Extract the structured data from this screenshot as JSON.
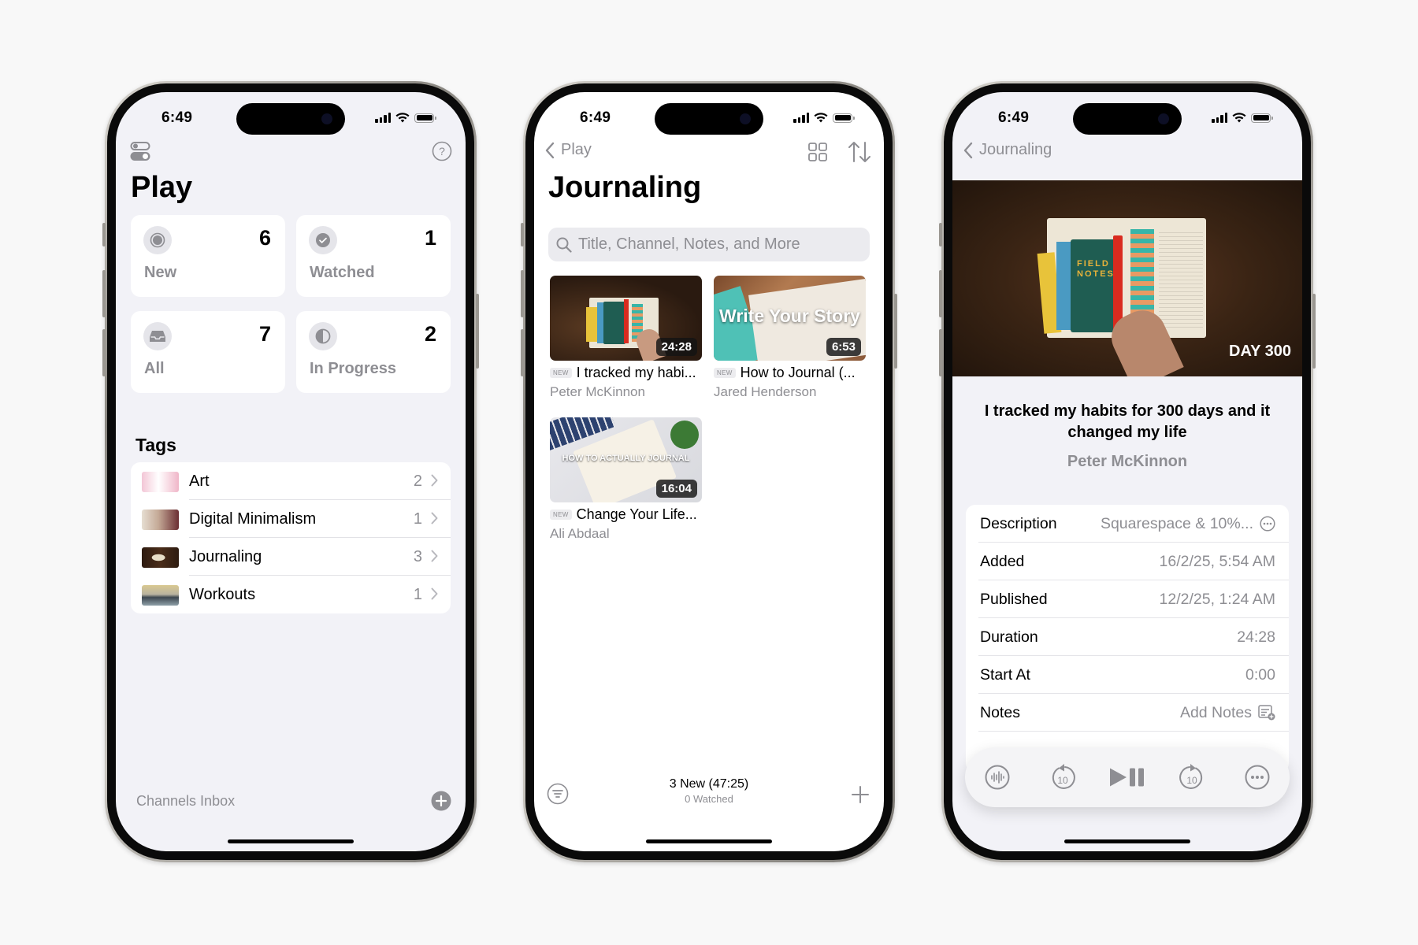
{
  "status_bar": {
    "time": "6:49"
  },
  "phone1": {
    "title": "Play",
    "cards": [
      {
        "label": "New",
        "count": "6",
        "icon": "record-circle-icon"
      },
      {
        "label": "Watched",
        "count": "1",
        "icon": "checkmark-circle-icon"
      },
      {
        "label": "All",
        "count": "7",
        "icon": "tray-icon"
      },
      {
        "label": "In Progress",
        "count": "2",
        "icon": "half-circle-icon"
      }
    ],
    "tags_header": "Tags",
    "tags": [
      {
        "name": "Art",
        "count": "2",
        "thumb_colors": [
          "#f3c6d6",
          "#ffffff"
        ]
      },
      {
        "name": "Digital Minimalism",
        "count": "1",
        "thumb_colors": [
          "#d9cbb8",
          "#6b2e33"
        ]
      },
      {
        "name": "Journaling",
        "count": "3",
        "thumb_colors": [
          "#3b2416",
          "#2f6f66"
        ]
      },
      {
        "name": "Workouts",
        "count": "1",
        "thumb_colors": [
          "#c9b98a",
          "#3d4750"
        ]
      }
    ],
    "footer_label": "Channels Inbox"
  },
  "phone2": {
    "back_label": "Play",
    "title": "Journaling",
    "search_placeholder": "Title, Channel, Notes, and More",
    "videos": [
      {
        "badge": "NEW",
        "title": "I tracked my habi...",
        "channel": "Peter McKinnon",
        "duration": "24:28",
        "overlay": ""
      },
      {
        "badge": "NEW",
        "title": "How to Journal (...",
        "channel": "Jared Henderson",
        "duration": "6:53",
        "overlay": "Write Your Story"
      },
      {
        "badge": "NEW",
        "title": "Change Your Life...",
        "channel": "Ali Abdaal",
        "duration": "16:04",
        "overlay": "HOW TO ACTUALLY JOURNAL"
      }
    ],
    "summary_primary": "3 New (47:25)",
    "summary_secondary": "0 Watched"
  },
  "phone3": {
    "back_label": "Journaling",
    "hero_overlay": "DAY 300",
    "video_title": "I tracked my habits for 300 days and it changed my life",
    "channel": "Peter McKinnon",
    "details": [
      {
        "key": "Description",
        "value": "Squarespace & 10%...",
        "icon": "ellipsis-circle-icon"
      },
      {
        "key": "Added",
        "value": "16/2/25, 5:54 AM"
      },
      {
        "key": "Published",
        "value": "12/2/25, 1:24 AM"
      },
      {
        "key": "Duration",
        "value": "24:28"
      },
      {
        "key": "Start At",
        "value": "0:00"
      },
      {
        "key": "Notes",
        "value": "Add Notes",
        "icon": "add-note-icon"
      }
    ],
    "controls": [
      "waveform-icon",
      "skip-back-10-icon",
      "play-pause-icon",
      "skip-forward-10-icon",
      "more-icon"
    ],
    "skip_seconds": "10"
  },
  "colors": {
    "background": "#f8f8f8",
    "screen_bg": "#f2f2f7",
    "secondary_text": "#8e8e93",
    "card_bg": "#ffffff"
  }
}
